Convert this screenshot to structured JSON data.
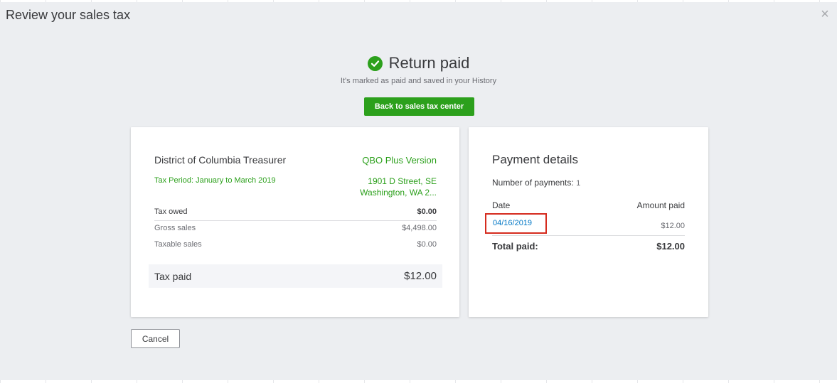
{
  "modal": {
    "title": "Review your sales tax",
    "close_icon": "close-icon"
  },
  "status": {
    "icon": "check-circle-icon",
    "title": "Return paid",
    "subtitle": "It's marked as paid and saved in your History",
    "primary_button": "Back to sales tax center"
  },
  "return_card": {
    "vendor": "District of Columbia Treasurer",
    "version": "QBO Plus Version",
    "tax_period": "Tax Period: January to March 2019",
    "address_line1": "1901 D Street, SE",
    "address_line2": "Washington, WA 2...",
    "rows": [
      {
        "label": "Tax owed",
        "amount": "$0.00"
      },
      {
        "label": "Gross sales",
        "amount": "$4,498.00"
      },
      {
        "label": "Taxable sales",
        "amount": "$0.00"
      }
    ],
    "tax_paid_label": "Tax paid",
    "tax_paid_amount": "$12.00"
  },
  "payment_details": {
    "title": "Payment details",
    "count_label": "Number of payments:",
    "count_value": "1",
    "col_date": "Date",
    "col_amount": "Amount paid",
    "payments": [
      {
        "date": "04/16/2019",
        "amount": "$12.00"
      }
    ],
    "total_label": "Total paid:",
    "total_amount": "$12.00"
  },
  "footer": {
    "cancel_label": "Cancel"
  },
  "colors": {
    "brand_green": "#2ca01c",
    "link_blue": "#0077c5",
    "highlight_red": "#d52b1e"
  }
}
